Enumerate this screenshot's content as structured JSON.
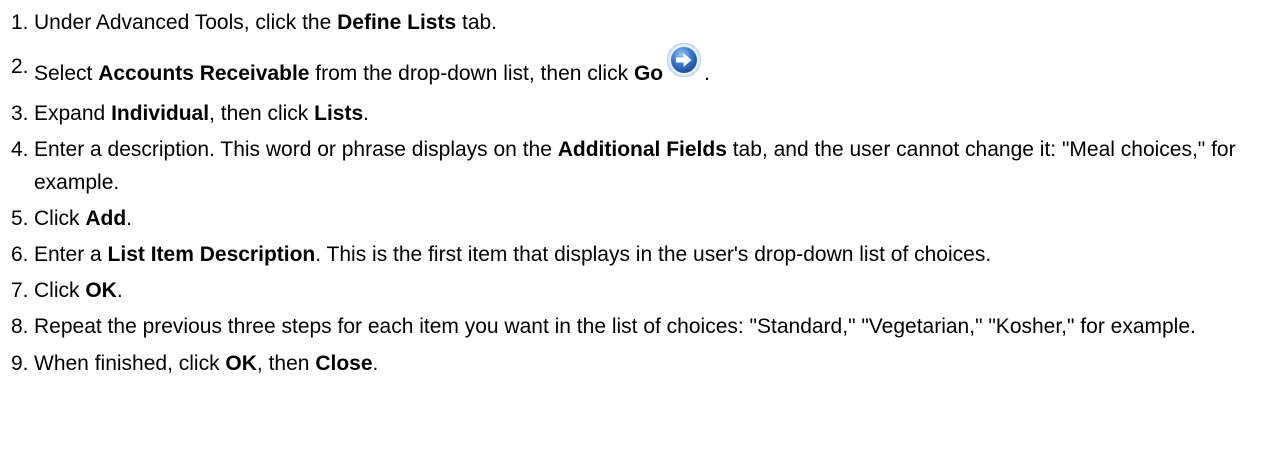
{
  "steps": [
    {
      "num": "1.",
      "t1": "Under Advanced Tools, click the ",
      "b1": "Define Lists",
      "t2": " tab."
    },
    {
      "num": "2.",
      "t1": "Select ",
      "b1": "Accounts Receivable",
      "t2": " from the drop-down list, then click ",
      "b2": "Go",
      "icon": "go-arrow-icon",
      "t3": "."
    },
    {
      "num": "3.",
      "t1": "Expand ",
      "b1": "Individual",
      "t2": ", then click ",
      "b2": "Lists",
      "t3": "."
    },
    {
      "num": "4.",
      "t1": "Enter a description. This word or phrase displays on the ",
      "b1": "Additional Fields",
      "t2": " tab, and the user cannot change it: \"Meal choices,\" for example."
    },
    {
      "num": "5.",
      "t1": "Click ",
      "b1": "Add",
      "t2": "."
    },
    {
      "num": "6.",
      "t1": "Enter a ",
      "b1": "List Item Description",
      "t2": ". This is the first item that displays in the user's drop-down list of choices."
    },
    {
      "num": "7.",
      "t1": "Click ",
      "b1": "OK",
      "t2": "."
    },
    {
      "num": "8.",
      "t1": "Repeat the previous three steps for each item you want in the list of choices: \"Standard,\" \"Vegetarian,\" \"Kosher,\" for example."
    },
    {
      "num": "9.",
      "t1": "When finished, click ",
      "b1": "OK",
      "t2": ", then ",
      "b2": "Close",
      "t3": "."
    }
  ],
  "colors": {
    "text": "#000000",
    "background": "#ffffff",
    "icon_blue": "#3a78c8",
    "icon_ring": "#bcd7f2"
  }
}
